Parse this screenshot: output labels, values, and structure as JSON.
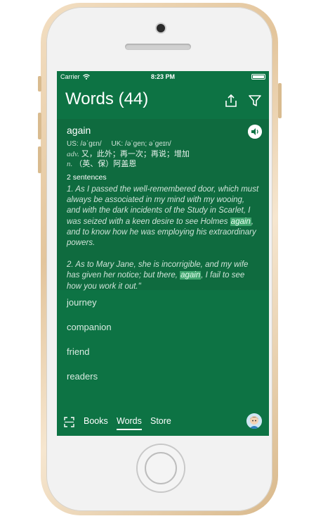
{
  "status_bar": {
    "carrier": "Carrier",
    "time": "8:23 PM"
  },
  "header": {
    "title": "Words (44)",
    "share_icon": "share-icon",
    "filter_icon": "filter-icon"
  },
  "card": {
    "word": "again",
    "phonetic_us": "US: /əˈɡɛn/",
    "phonetic_uk": "UK: /əˈɡen; əˈɡeɪn/",
    "pos_adv": "adv.",
    "def_adv": " 又，此外；再一次；再说；增加",
    "pos_n": "n.",
    "def_n": " （英、保）阿盖恩",
    "sentence_count": "2 sentences",
    "s1_before": "1. As I passed the well-remembered door, which must always be associated in my mind with my wooing, and with the dark incidents of the Study in Scarlet, I was seized with a keen desire to see Holmes ",
    "s1_hl": "again",
    "s1_after": ", and to know how he was employing his extraordinary powers.",
    "s2_before": "2. As to Mary Jane, she is incorrigible, and my wife has given her notice; but there, ",
    "s2_hl": "again",
    "s2_after": ", I fail to see how you work it out.\""
  },
  "list": {
    "items": [
      "journey",
      "companion",
      "friend",
      "readers"
    ]
  },
  "tabbar": {
    "scan_icon": "scan-icon",
    "books": "Books",
    "words": "Words",
    "store": "Store",
    "active": "Words"
  },
  "colors": {
    "app_green": "#0d7344",
    "card_green": "#0f6b3f",
    "highlight": "#41a66f"
  }
}
